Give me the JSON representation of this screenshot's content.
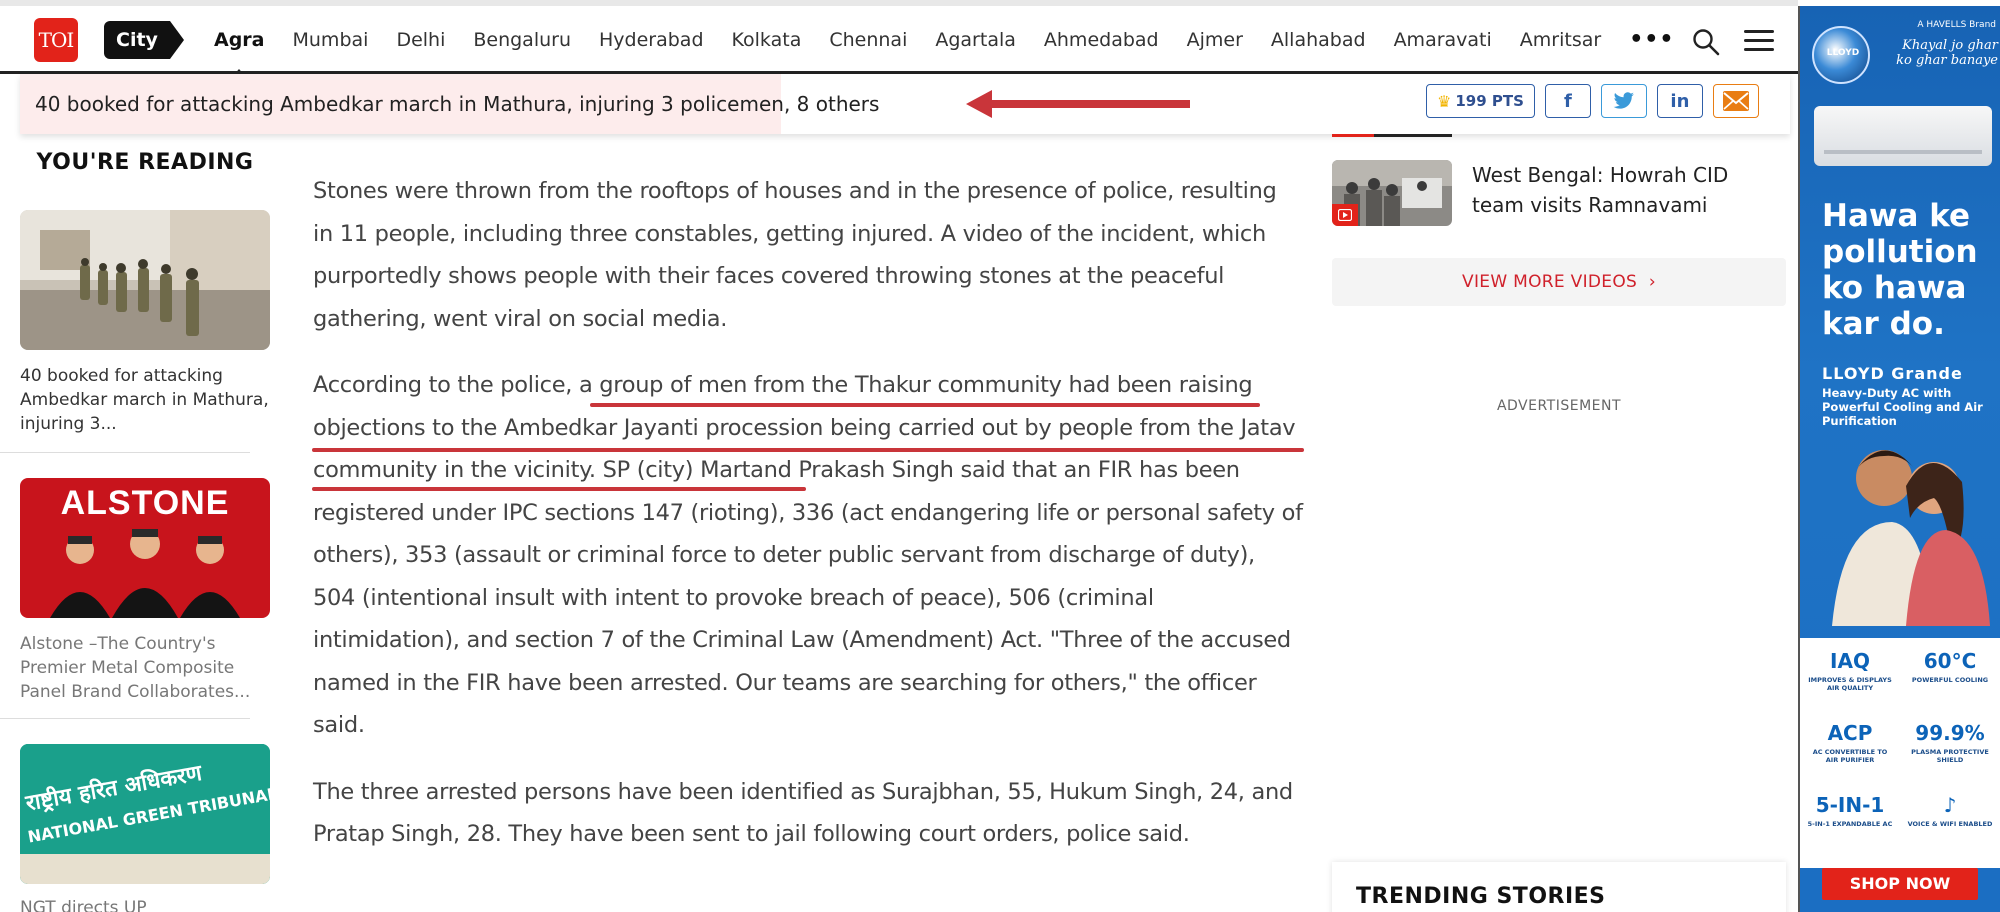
{
  "nav": {
    "logo": "TOI",
    "section": "City",
    "cities": [
      "Agra",
      "Mumbai",
      "Delhi",
      "Bengaluru",
      "Hyderabad",
      "Kolkata",
      "Chennai",
      "Agartala",
      "Ahmedabad",
      "Ajmer",
      "Allahabad",
      "Amaravati",
      "Amritsar"
    ],
    "active_city": "Agra",
    "more": "•••"
  },
  "sticky": {
    "headline": "40 booked for attacking Ambedkar march in Mathura, injuring 3 policemen, 8 others",
    "points": "199 PTS",
    "share": {
      "facebook": "f",
      "linkedin": "in"
    },
    "read_progress": 0.43
  },
  "left_rail": {
    "title": "YOU'RE READING",
    "cards": [
      {
        "caption": "40 booked for attacking Ambedkar march in Mathura, injuring 3..."
      },
      {
        "caption": "Alstone –The Country's Premier Metal Composite Panel Brand Collaborates...",
        "thumb_text": "ALSTONE"
      },
      {
        "caption": "NGT directs UP",
        "thumb_lines": [
          "राष्ट्रीय हरित अधिकरण",
          "NATIONAL GREEN TRIBUNAL"
        ]
      }
    ]
  },
  "article": {
    "paragraphs": [
      "Stones were thrown from the rooftops of houses and in the presence of police, resulting in 11 people, including three constables, getting injured. A video of the incident, which purportedly shows people with their faces covered throwing stones at the peaceful gathering, went viral on social media.",
      "According to the police, a group of men from the Thakur community had been raising objections to the Ambedkar Jayanti procession being carried out by people from the Jatav community in the vicinity. SP (city) Martand Prakash Singh said that an FIR has been registered under IPC sections 147 (rioting), 336 (act endangering life or personal safety of others), 353 (assault or criminal force to deter public servant from discharge of duty), 504 (intentional insult with intent to provoke breach of peace), 506 (criminal intimidation), and section 7 of the Criminal Law (Amendment) Act. \"Three of the accused named in the FIR have been arrested. Our teams are searching for others,\" the officer said.",
      "The three arrested persons have been identified as Surajbhan, 55, Hukum Singh, 24, and Pratap Singh, 28. They have been sent to jail following court orders, police said."
    ]
  },
  "right_col": {
    "video_title": "West Bengal: Howrah CID team visits Ramnavami",
    "view_more": "VIEW MORE VIDEOS",
    "advertisement": "ADVERTISEMENT",
    "trending": "TRENDING STORIES"
  },
  "ad": {
    "havells": "A HAVELLS Brand",
    "tagline": "Khayal jo ghar ko ghar banaye",
    "logo_text": "LLOYD",
    "headline": "Hawa ke pollution ko hawa kar do.",
    "brand": "LLOYD Grande",
    "sub": "Heavy-Duty AC with Powerful Cooling and Air Purification",
    "features": [
      {
        "big": "IAQ",
        "label": "IMPROVES & DISPLAYS AIR QUALITY"
      },
      {
        "big": "60°C",
        "label": "POWERFUL COOLING"
      },
      {
        "big": "ACP",
        "label": "AC CONVERTIBLE TO AIR PURIFIER"
      },
      {
        "big": "99.9%",
        "label": "PLASMA PROTECTIVE SHIELD"
      },
      {
        "big": "5-IN-1",
        "label": "5-IN-1 EXPANDABLE AC"
      },
      {
        "big": "♪",
        "label": "VOICE & WIFI ENABLED"
      }
    ],
    "cta": "SHOP NOW"
  }
}
